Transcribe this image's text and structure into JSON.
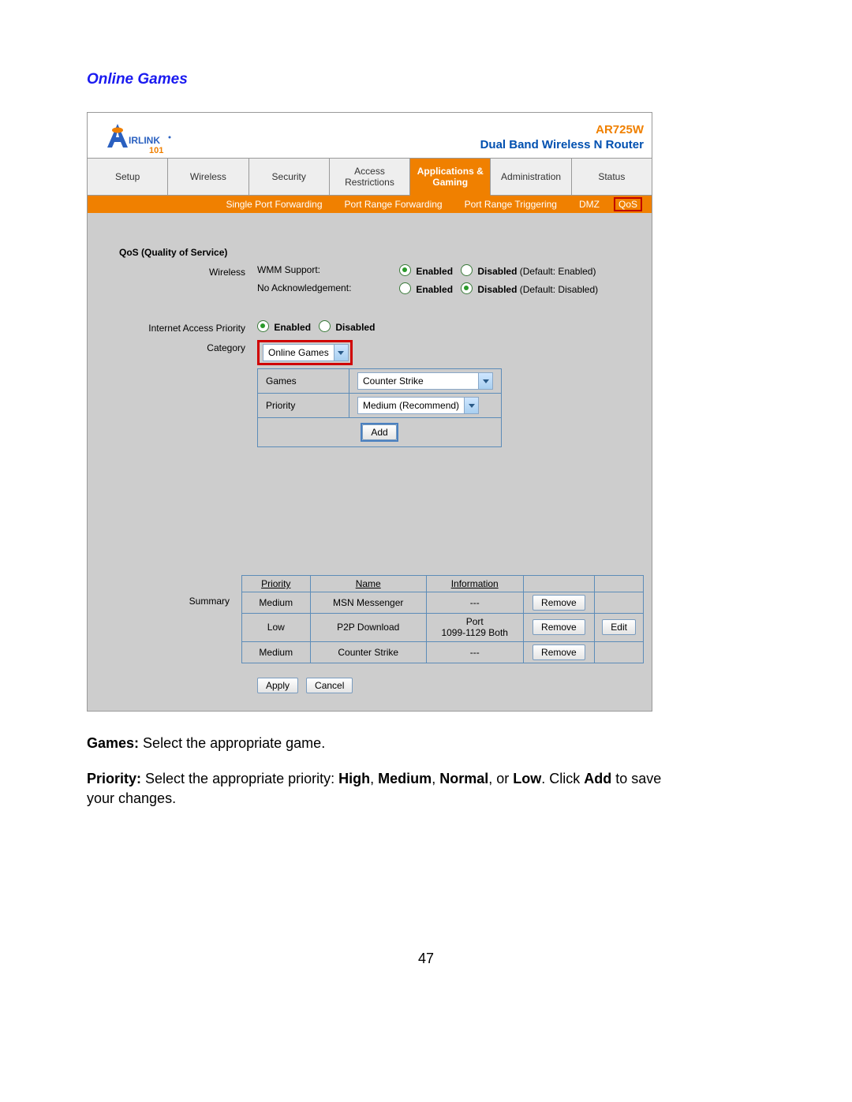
{
  "heading": "Online Games",
  "header": {
    "model": "AR725W",
    "tagline": "Dual Band Wireless N Router"
  },
  "tabs": [
    "Setup",
    "Wireless",
    "Security",
    "Access Restrictions",
    "Applications & Gaming",
    "Administration",
    "Status"
  ],
  "active_tab": "Applications & Gaming",
  "subnav": [
    "Single Port Forwarding",
    "Port Range Forwarding",
    "Port Range Triggering",
    "DMZ",
    "QoS"
  ],
  "subnav_active": "QoS",
  "section_title": "QoS (Quality of Service)",
  "wireless": {
    "label": "Wireless",
    "wmm_label": "WMM Support:",
    "wmm_enabled": "Enabled",
    "wmm_disabled": "Disabled",
    "wmm_default": "(Default: Enabled)",
    "noack_label": "No Acknowledgement:",
    "noack_enabled": "Enabled",
    "noack_disabled": "Disabled",
    "noack_default": "(Default: Disabled)"
  },
  "iap": {
    "label": "Internet Access Priority",
    "enabled": "Enabled",
    "disabled": "Disabled",
    "cat_label": "Category",
    "cat_value": "Online Games",
    "games_lbl": "Games",
    "games_value": "Counter Strike",
    "priority_lbl": "Priority",
    "priority_value": "Medium (Recommend)",
    "add_btn": "Add"
  },
  "summary": {
    "label": "Summary",
    "cols": [
      "Priority",
      "Name",
      "Information",
      "",
      ""
    ],
    "rows": [
      {
        "priority": "Medium",
        "name": "MSN Messenger",
        "info": "---",
        "remove": "Remove",
        "edit": ""
      },
      {
        "priority": "Low",
        "name": "P2P Download",
        "info": "Port\n1099-1129   Both",
        "remove": "Remove",
        "edit": "Edit"
      },
      {
        "priority": "Medium",
        "name": "Counter Strike",
        "info": "---",
        "remove": "Remove",
        "edit": ""
      }
    ]
  },
  "apply_btn": "Apply",
  "cancel_btn": "Cancel",
  "doc": {
    "games_label": "Games:",
    "games_text": " Select the appropriate game.",
    "priority_label": "Priority:",
    "priority_text_a": " Select the appropriate priority: ",
    "high": "High",
    "medium": "Medium",
    "normal": "Normal",
    "low": "Low",
    "or": ", or ",
    "sep": ", ",
    "period": ". Click ",
    "add": "Add",
    "tail": " to save your changes."
  },
  "page_number": "47"
}
